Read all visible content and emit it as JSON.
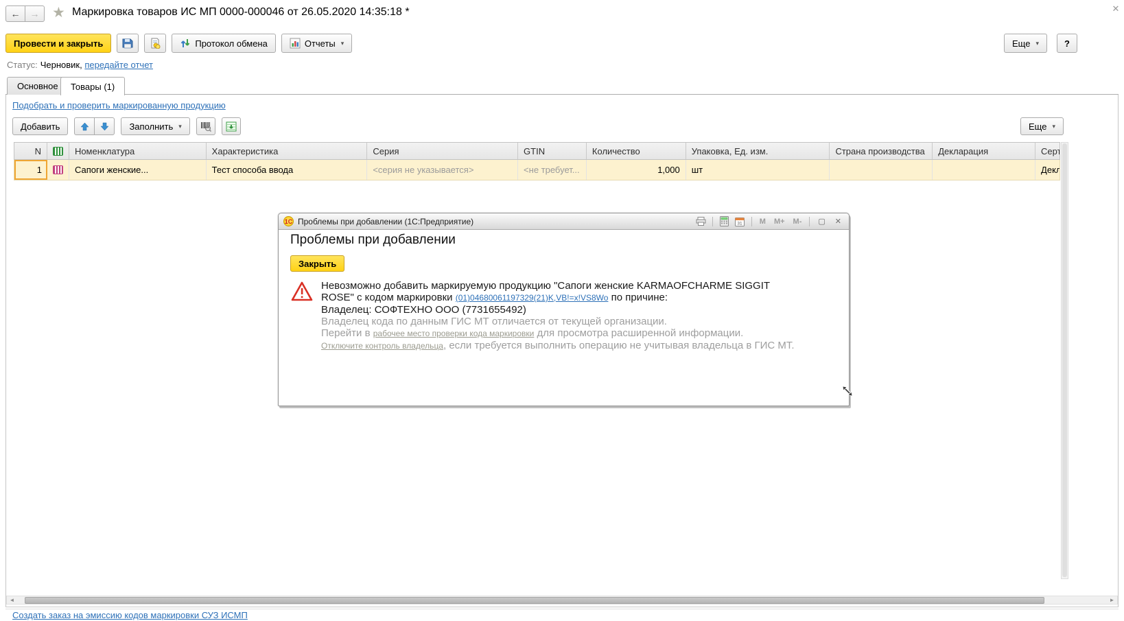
{
  "window": {
    "title": "Маркировка товаров ИС МП 0000-000046 от 26.05.2020 14:35:18 *"
  },
  "icons": {
    "back": "←",
    "forward": "→",
    "star": "★",
    "window_close": "✕",
    "caret": "▾",
    "maximize": "▢",
    "dialog_close": "✕",
    "warning": "!",
    "scroll_left": "◄",
    "scroll_right": "►"
  },
  "toolbar": {
    "post_close": "Провести и закрыть",
    "protocol": "Протокол обмена",
    "reports": "Отчеты",
    "more": "Еще",
    "help": "?"
  },
  "status": {
    "label": "Статус:",
    "value": "Черновик,",
    "link": "передайте отчет"
  },
  "tabs": {
    "main": "Основное",
    "goods": "Товары (1)"
  },
  "goods": {
    "pick_link": "Подобрать и проверить маркированную продукцию",
    "add": "Добавить",
    "fill": "Заполнить",
    "more": "Еще",
    "columns": {
      "n": "N",
      "nomenclature": "Номенклатура",
      "characteristic": "Характеристика",
      "series": "Серия",
      "gtin": "GTIN",
      "quantity": "Количество",
      "package": "Упаковка, Ед. изм.",
      "country": "Страна производства",
      "declaration": "Декларация",
      "certificate": "Серт"
    },
    "row": {
      "n": "1",
      "nomenclature": "Сапоги женские...",
      "characteristic": "Тест способа ввода",
      "series": "<серия не указывается>",
      "gtin": "<не требует...",
      "quantity": "1,000",
      "package": "шт",
      "country": "",
      "declaration": "",
      "certificate": "Декл"
    }
  },
  "dialog": {
    "title": "Проблемы при добавлении  (1С:Предприятие)",
    "m": "M",
    "m_plus": "M+",
    "m_minus": "M-",
    "heading": "Проблемы при добавлении",
    "close": "Закрыть",
    "msg_before_code": "Невозможно добавить маркируемую продукцию \"Сапоги женские KARMAOFCHARME SIGGIT ROSE\" с кодом маркировки ",
    "msg_code_link": "(01)04680061197329(21)K,VB!=x!VS8Wo",
    "msg_after_code": " по причине:",
    "owner_line": "Владелец: СОФТЕХНО ООО (7731655492)",
    "gray_line1": "Владелец кода по данным ГИС МТ отличается от текущей организации.",
    "goto_before": "Перейти в ",
    "goto_link": "рабочее место проверки кода маркировки",
    "goto_after": " для просмотра расширенной информации.",
    "disable_link": "Отключите контроль владельца",
    "disable_after": ", если требуется выполнить операцию не учитывая владельца в ГИС МТ."
  },
  "footer": {
    "create_order_link": "Создать заказ на эмиссию кодов маркировки СУЗ ИСМП"
  },
  "colors": {
    "accent_yellow": "#FFD215",
    "link_blue": "#2E71B8",
    "row_highlight": "#FDF2CF",
    "warning_red": "#D93025"
  }
}
